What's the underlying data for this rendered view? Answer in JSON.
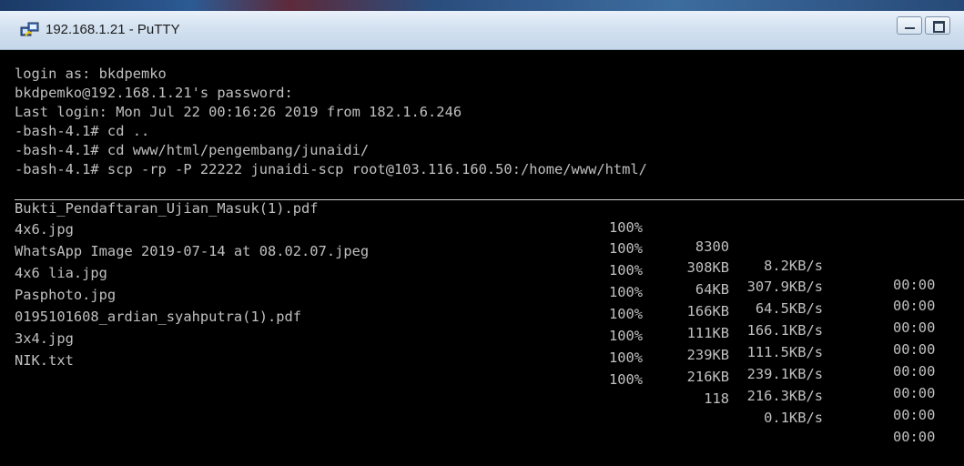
{
  "desktop": {
    "strip_colors": [
      "#1b3a66",
      "#2c5a93",
      "#5d2a3a",
      "#3d6c9f"
    ]
  },
  "window": {
    "title": "192.168.1.21 - PuTTY",
    "icon": "putty-icon"
  },
  "terminal": {
    "background": "#000000",
    "text_color": "#c0c0c0",
    "lines": [
      "login as: bkdpemko",
      "bkdpemko@192.168.1.21's password:",
      "Last login: Mon Jul 22 00:16:26 2019 from 182.1.6.246",
      "-bash-4.1# cd ..",
      "-bash-4.1# cd www/html/pengembang/junaidi/",
      "-bash-4.1# scp -rp -P 22222 junaidi-scp root@103.116.160.50:/home/www/html/"
    ],
    "transfers": [
      {
        "name": "Bukti_Pendaftaran_Ujian_Masuk(1).pdf",
        "percent": "100%",
        "size": "8300",
        "rate": "8.2KB/s",
        "time": "00:00"
      },
      {
        "name": "4x6.jpg",
        "percent": "100%",
        "size": "308KB",
        "rate": "307.9KB/s",
        "time": "00:00"
      },
      {
        "name": "WhatsApp Image 2019-07-14 at 08.02.07.jpeg",
        "percent": "100%",
        "size": "64KB",
        "rate": "64.5KB/s",
        "time": "00:00"
      },
      {
        "name": "4x6 lia.jpg",
        "percent": "100%",
        "size": "166KB",
        "rate": "166.1KB/s",
        "time": "00:00"
      },
      {
        "name": "Pasphoto.jpg",
        "percent": "100%",
        "size": "111KB",
        "rate": "111.5KB/s",
        "time": "00:00"
      },
      {
        "name": "0195101608_ardian_syahputra(1).pdf",
        "percent": "100%",
        "size": "239KB",
        "rate": "239.1KB/s",
        "time": "00:00"
      },
      {
        "name": "3x4.jpg",
        "percent": "100%",
        "size": "216KB",
        "rate": "216.3KB/s",
        "time": "00:00"
      },
      {
        "name": "NIK.txt",
        "percent": "100%",
        "size": "118",
        "rate": "0.1KB/s",
        "time": "00:00"
      }
    ]
  }
}
